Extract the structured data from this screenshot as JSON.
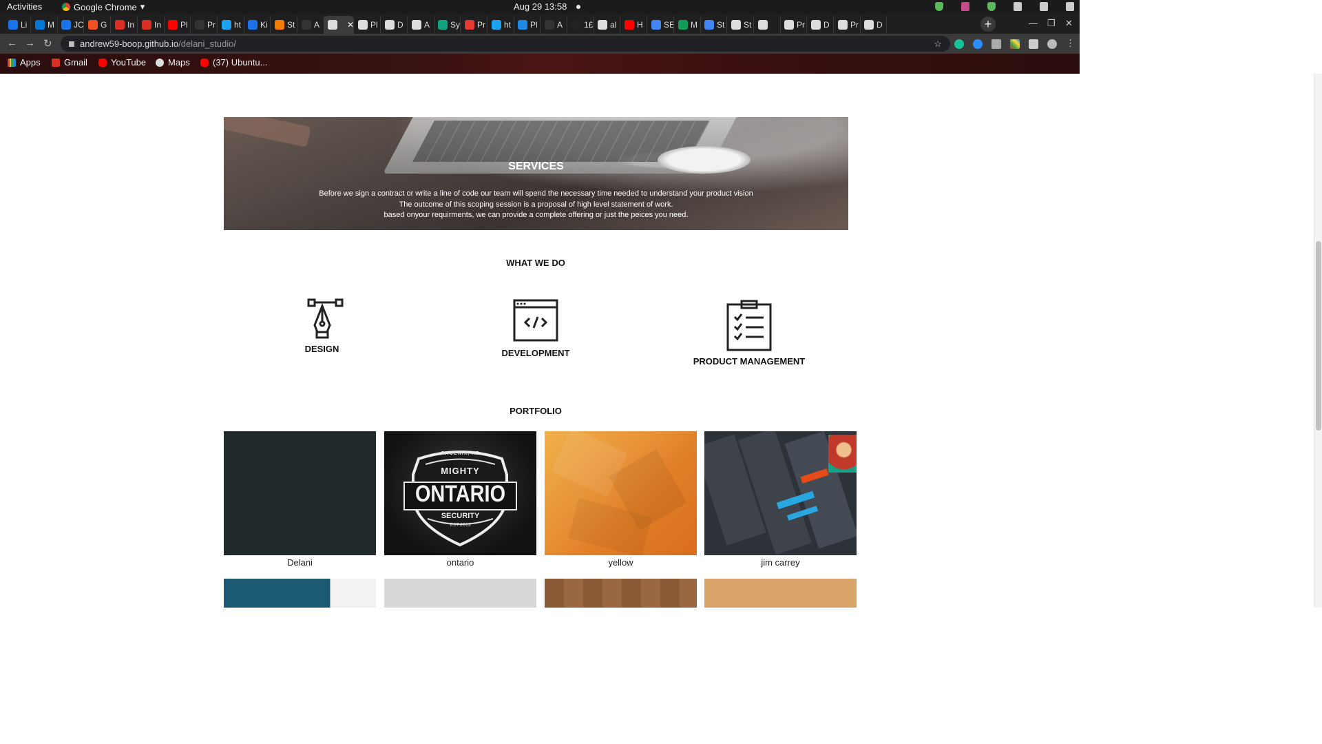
{
  "os": {
    "activities": "Activities",
    "app_name": "Google Chrome",
    "datetime": "Aug 29  13:58"
  },
  "browser": {
    "tabs": [
      "Li",
      "M",
      "JC",
      "G",
      "In",
      "In",
      "Pl",
      "Pr",
      "ht",
      "Ki",
      "St",
      "A",
      "",
      "Pl",
      "D",
      "A",
      "Sy",
      "Pr",
      "ht",
      "Pl",
      "A",
      "1£",
      "al",
      "H",
      "SE",
      "M",
      "St",
      "St",
      "",
      "Pr",
      "D",
      "Pr",
      "D"
    ],
    "url_host": "andrew59-boop.github.io",
    "url_path": "/delani_studio/",
    "bookmarks": [
      "Apps",
      "Gmail",
      "YouTube",
      "Maps",
      "(37) Ubuntu..."
    ]
  },
  "services": {
    "title": "SERVICES",
    "lines": [
      "Before we sign a contract or write a line of code our team will spend the necessary time needed to understand your product vision",
      "The outcome of this scoping session is a proposal of high level statement of work.",
      "based onyour requirments, we can provide a complete offering or just the peices you need."
    ]
  },
  "what_we_do": {
    "title": "WHAT WE DO",
    "items": [
      "DESIGN",
      "DEVELOPMENT",
      "PRODUCT MANAGEMENT"
    ]
  },
  "portfolio": {
    "title": "PORTFOLIO",
    "items": [
      "Delani",
      "ontario",
      "yellow",
      "jim carrey"
    ],
    "ontario_badge": {
      "top": "PHOENIX, AZ",
      "line1": "MIGHTY",
      "line2": "ONTARIO",
      "line3": "SECURITY",
      "bottom": "EST.2013"
    }
  }
}
